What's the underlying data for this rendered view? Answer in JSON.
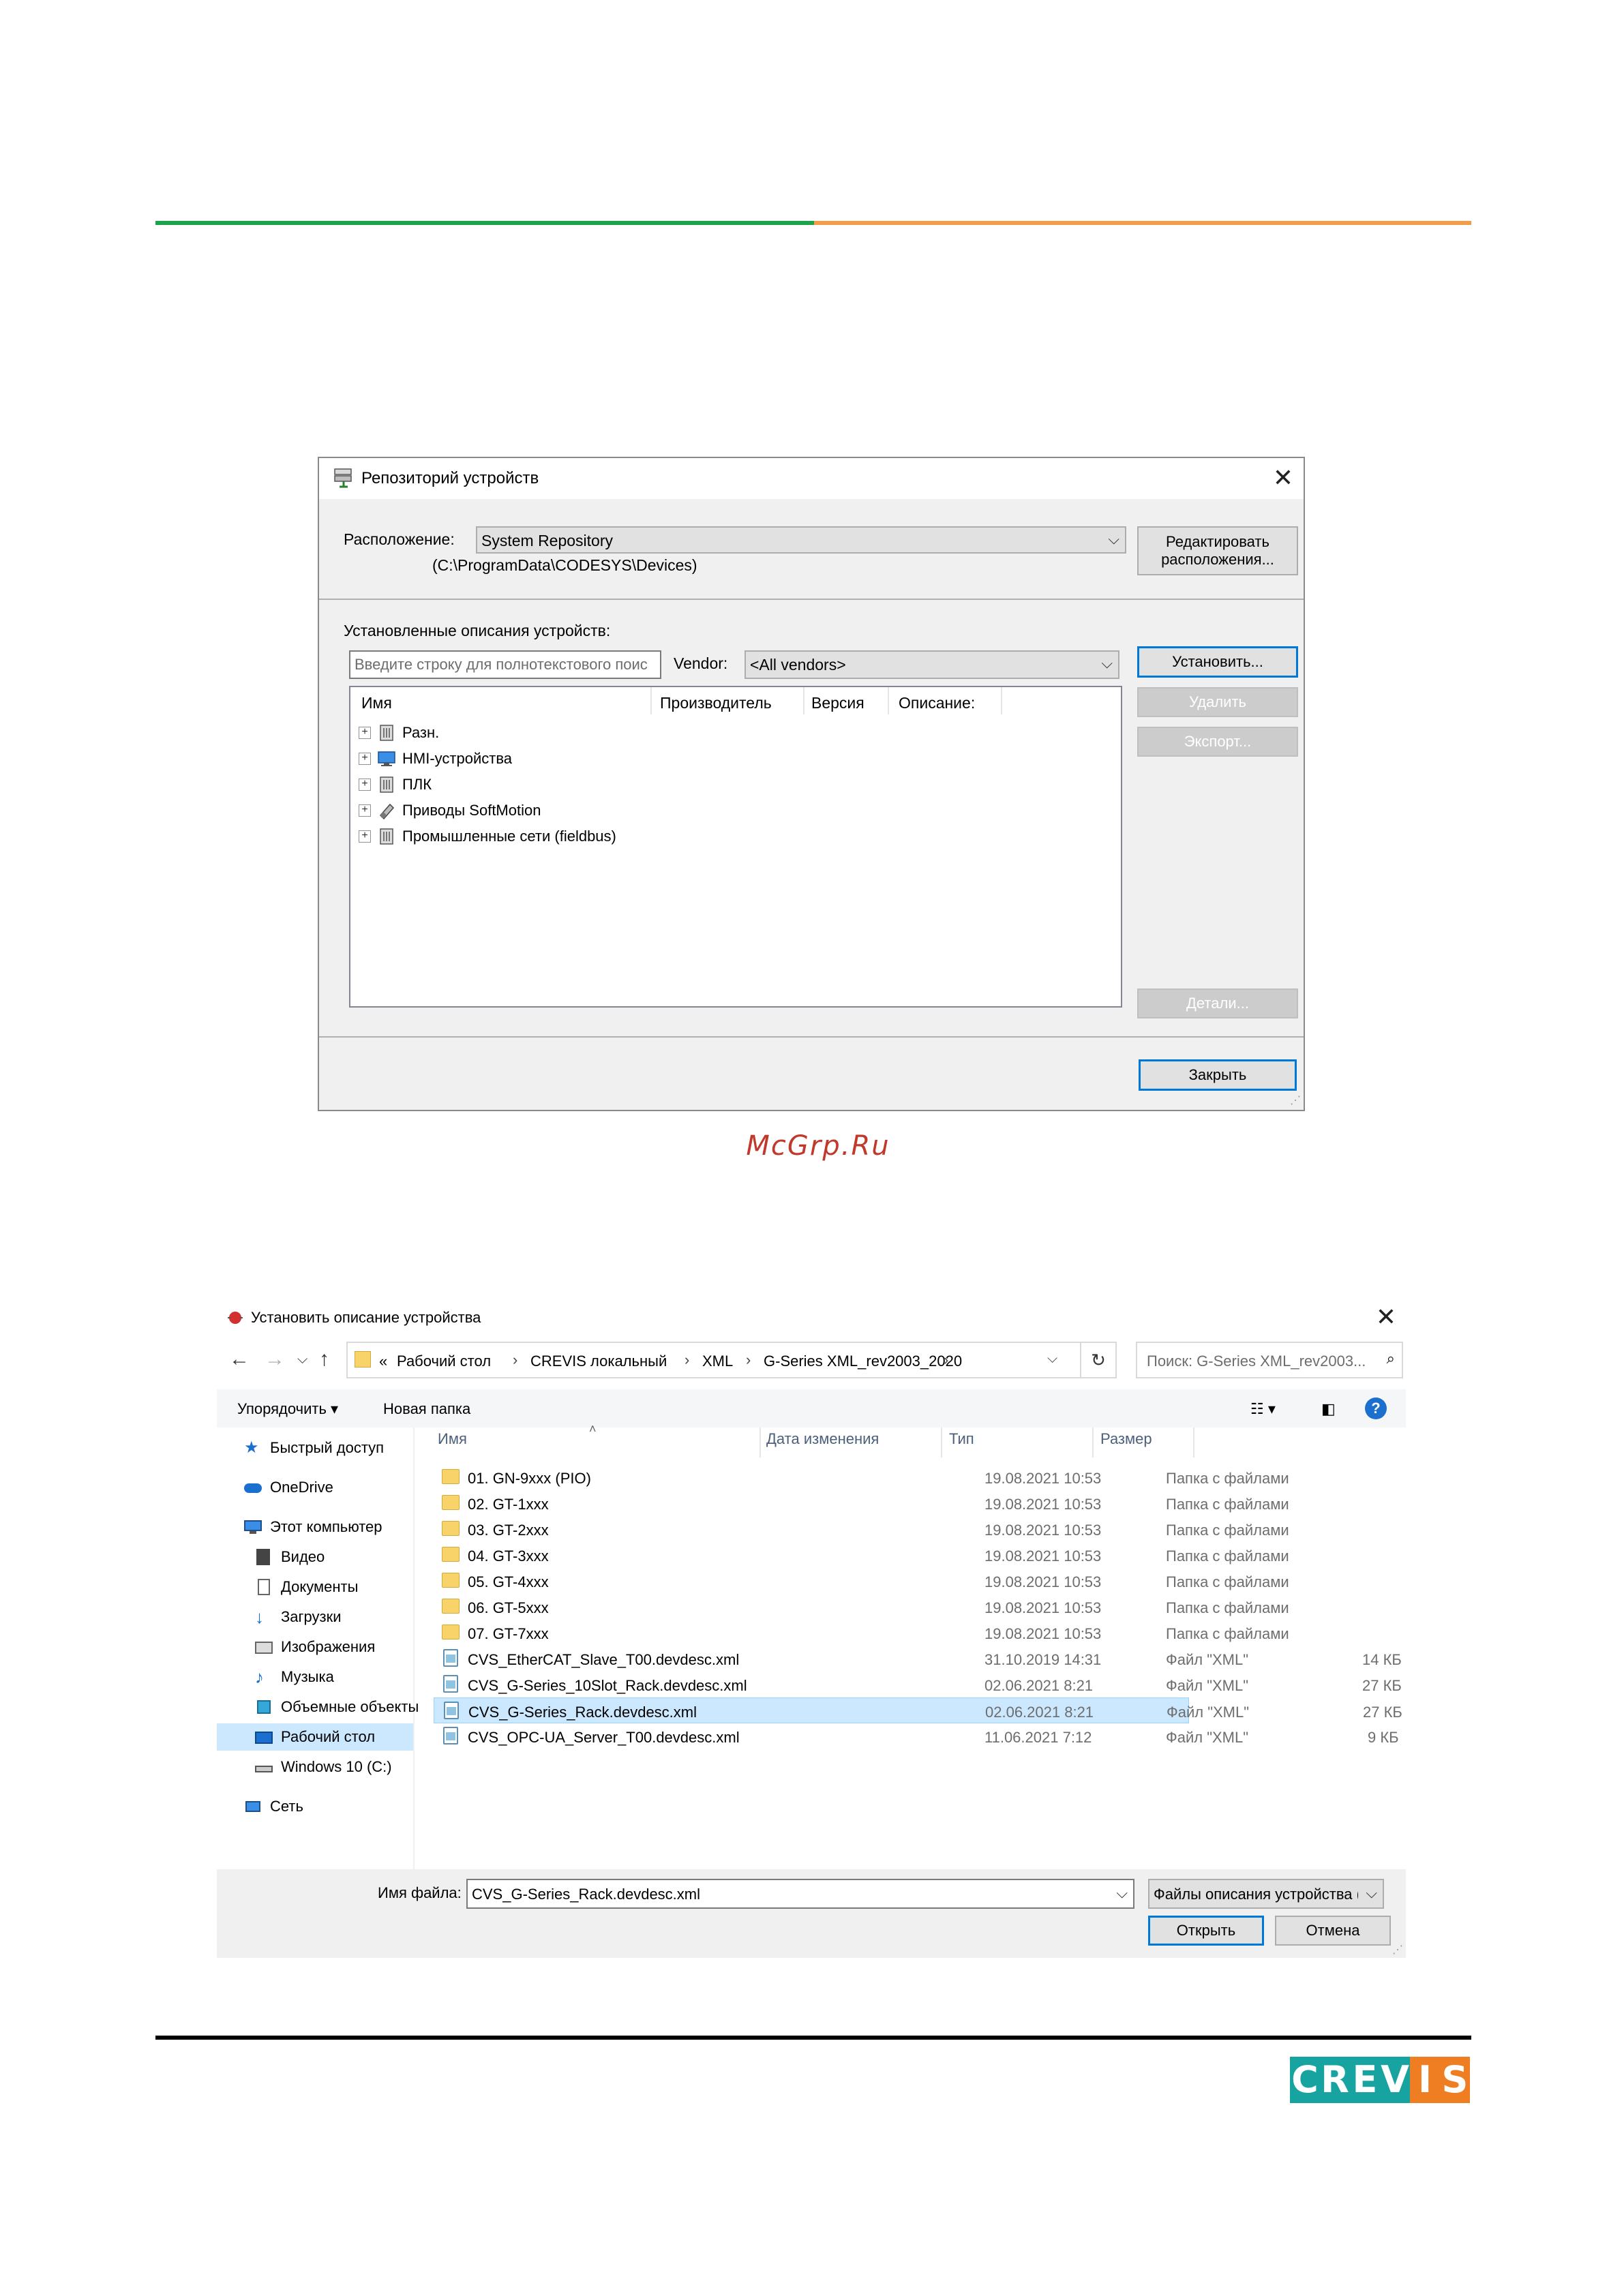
{
  "repo_dialog": {
    "title": "Репозиторий устройств",
    "location_label": "Расположение:",
    "location_value": "System Repository",
    "location_path": "(C:\\ProgramData\\CODESYS\\Devices)",
    "edit_locations_button": "Редактировать расположения...",
    "installed_label": "Установленные описания устройств:",
    "search_placeholder": "Введите строку для полнотекстового поис",
    "vendor_label": "Vendor:",
    "vendor_value": "<All vendors>",
    "columns": {
      "name": "Имя",
      "vendor": "Производитель",
      "version": "Версия",
      "description": "Описание:"
    },
    "tree_items": [
      {
        "label": "Разн.",
        "icon": "device-generic-icon"
      },
      {
        "label": "HMI-устройства",
        "icon": "monitor-icon"
      },
      {
        "label": "ПЛК",
        "icon": "plc-icon"
      },
      {
        "label": "Приводы SoftMotion",
        "icon": "drive-icon"
      },
      {
        "label": "Промышленные сети (fieldbus)",
        "icon": "fieldbus-icon"
      }
    ],
    "install_button": "Установить...",
    "delete_button": "Удалить",
    "export_button": "Экспорт...",
    "details_button": "Детали...",
    "close_button": "Закрыть"
  },
  "watermark": "McGrp.Ru",
  "file_dialog": {
    "title": "Установить описание устройства",
    "breadcrumb": [
      "«",
      "Рабочий стол",
      "CREVIS локальный",
      "XML",
      "G-Series XML_rev2003_2020"
    ],
    "search_placeholder": "Поиск: G-Series XML_rev2003...",
    "toolbar": {
      "organize": "Упорядочить",
      "new_folder": "Новая папка"
    },
    "nav": {
      "quick_access": "Быстрый доступ",
      "onedrive": "OneDrive",
      "this_pc": "Этот компьютер",
      "video": "Видео",
      "documents": "Документы",
      "downloads": "Загрузки",
      "pictures": "Изображения",
      "music": "Музыка",
      "objects3d": "Объемные объекты",
      "desktop": "Рабочий стол",
      "drive_c": "Windows 10 (C:)",
      "network": "Сеть"
    },
    "columns": {
      "name": "Имя",
      "date": "Дата изменения",
      "type": "Тип",
      "size": "Размер"
    },
    "files": [
      {
        "name": "01. GN-9xxx (PIO)",
        "date": "19.08.2021 10:53",
        "type": "Папка с файлами",
        "size": "",
        "kind": "folder"
      },
      {
        "name": "02. GT-1xxx",
        "date": "19.08.2021 10:53",
        "type": "Папка с файлами",
        "size": "",
        "kind": "folder"
      },
      {
        "name": "03. GT-2xxx",
        "date": "19.08.2021 10:53",
        "type": "Папка с файлами",
        "size": "",
        "kind": "folder"
      },
      {
        "name": "04. GT-3xxx",
        "date": "19.08.2021 10:53",
        "type": "Папка с файлами",
        "size": "",
        "kind": "folder"
      },
      {
        "name": "05. GT-4xxx",
        "date": "19.08.2021 10:53",
        "type": "Папка с файлами",
        "size": "",
        "kind": "folder"
      },
      {
        "name": "06. GT-5xxx",
        "date": "19.08.2021 10:53",
        "type": "Папка с файлами",
        "size": "",
        "kind": "folder"
      },
      {
        "name": "07. GT-7xxx",
        "date": "19.08.2021 10:53",
        "type": "Папка с файлами",
        "size": "",
        "kind": "folder"
      },
      {
        "name": "CVS_EtherCAT_Slave_T00.devdesc.xml",
        "date": "31.10.2019 14:31",
        "type": "Файл \"XML\"",
        "size": "14 КБ",
        "kind": "xml"
      },
      {
        "name": "CVS_G-Series_10Slot_Rack.devdesc.xml",
        "date": "02.06.2021 8:21",
        "type": "Файл \"XML\"",
        "size": "27 КБ",
        "kind": "xml"
      },
      {
        "name": "CVS_G-Series_Rack.devdesc.xml",
        "date": "02.06.2021 8:21",
        "type": "Файл \"XML\"",
        "size": "27 КБ",
        "kind": "xml",
        "selected": true
      },
      {
        "name": "CVS_OPC-UA_Server_T00.devdesc.xml",
        "date": "11.06.2021 7:12",
        "type": "Файл \"XML\"",
        "size": "9 КБ",
        "kind": "xml"
      }
    ],
    "filename_label": "Имя файла:",
    "filename_value": "CVS_G-Series_Rack.devdesc.xml",
    "filter_value": "Файлы описания устройства (",
    "open_button": "Открыть",
    "cancel_button": "Отмена"
  },
  "logo_text": "CREVIS",
  "colors": {
    "green": "#1aa34a",
    "orange": "#f29b4b",
    "selection": "#cce8ff",
    "accent": "#0078d7"
  }
}
